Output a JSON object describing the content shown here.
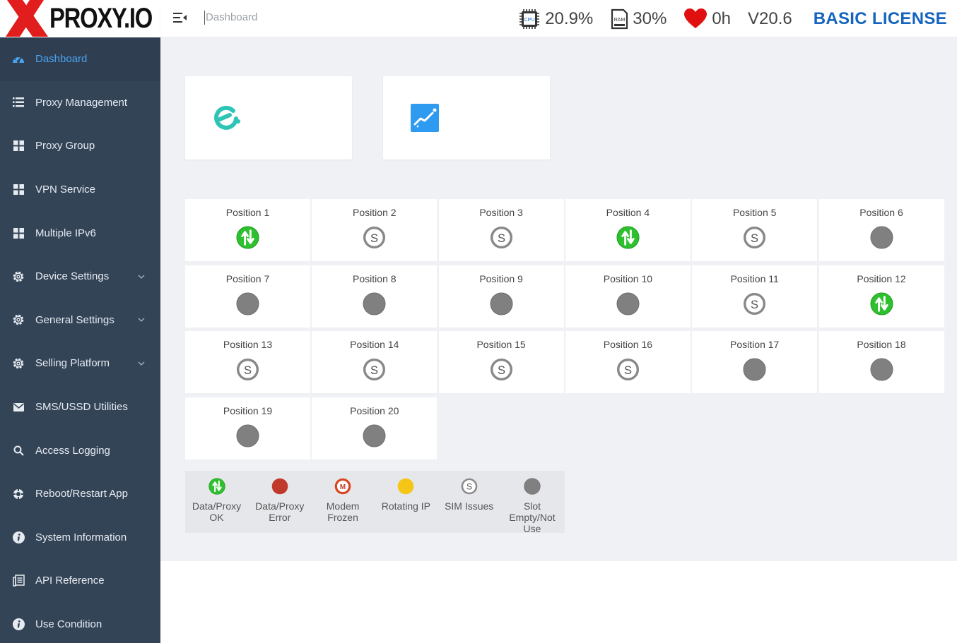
{
  "brand": {
    "logo_text": "PROXY.IO"
  },
  "topbar": {
    "breadcrumb": "Dashboard",
    "cpu": {
      "chip": "CPU",
      "value": "20.9%"
    },
    "ram": {
      "chip": "RAM",
      "value": "30%"
    },
    "uptime": "0h",
    "version": "V20.6",
    "license": "BASIC LICENSE"
  },
  "sidebar": {
    "items": [
      {
        "label": "Dashboard",
        "icon": "dashboard-icon"
      },
      {
        "label": "Proxy Management",
        "icon": "list-icon"
      },
      {
        "label": "Proxy Group",
        "icon": "grid-icon"
      },
      {
        "label": "VPN Service",
        "icon": "grid-icon"
      },
      {
        "label": "Multiple IPv6",
        "icon": "grid-icon"
      },
      {
        "label": "Device Settings",
        "icon": "gear-icon"
      },
      {
        "label": "General Settings",
        "icon": "gear-icon"
      },
      {
        "label": "Selling Platform",
        "icon": "gear-icon"
      },
      {
        "label": "SMS/USSD Utilities",
        "icon": "envelope-icon"
      },
      {
        "label": "Access Logging",
        "icon": "search-icon"
      },
      {
        "label": "Reboot/Restart App",
        "icon": "reboot-icon"
      },
      {
        "label": "System Information",
        "icon": "info-icon"
      },
      {
        "label": "API Reference",
        "icon": "document-icon"
      },
      {
        "label": "Use Condition",
        "icon": "info-icon"
      }
    ]
  },
  "positions": [
    {
      "label": "Position 1",
      "status": "ok"
    },
    {
      "label": "Position 2",
      "status": "sim"
    },
    {
      "label": "Position 3",
      "status": "sim"
    },
    {
      "label": "Position 4",
      "status": "ok"
    },
    {
      "label": "Position 5",
      "status": "sim"
    },
    {
      "label": "Position 6",
      "status": "empty"
    },
    {
      "label": "Position 7",
      "status": "empty"
    },
    {
      "label": "Position 8",
      "status": "empty"
    },
    {
      "label": "Position 9",
      "status": "empty"
    },
    {
      "label": "Position 10",
      "status": "empty"
    },
    {
      "label": "Position 11",
      "status": "sim"
    },
    {
      "label": "Position 12",
      "status": "ok"
    },
    {
      "label": "Position 13",
      "status": "sim"
    },
    {
      "label": "Position 14",
      "status": "sim"
    },
    {
      "label": "Position 15",
      "status": "sim"
    },
    {
      "label": "Position 16",
      "status": "sim"
    },
    {
      "label": "Position 17",
      "status": "empty"
    },
    {
      "label": "Position 18",
      "status": "empty"
    },
    {
      "label": "Position 19",
      "status": "empty"
    },
    {
      "label": "Position 20",
      "status": "empty"
    }
  ],
  "legend": [
    {
      "label": "Data/Proxy OK",
      "status": "ok"
    },
    {
      "label": "Data/Proxy Error",
      "status": "error"
    },
    {
      "label": "Modem Frozen",
      "status": "frozen"
    },
    {
      "label": "Rotating IP",
      "status": "rotating"
    },
    {
      "label": "SIM Issues",
      "status": "sim"
    },
    {
      "label": "Slot Empty/Not Use",
      "status": "empty"
    }
  ],
  "colors": {
    "sidebar_bg": "#344457",
    "active_nav": "#4aa3f0",
    "license": "#1565c0",
    "ok": "#2ec02e",
    "error": "#c0392b",
    "rotating": "#f5c518",
    "empty": "#808080"
  }
}
